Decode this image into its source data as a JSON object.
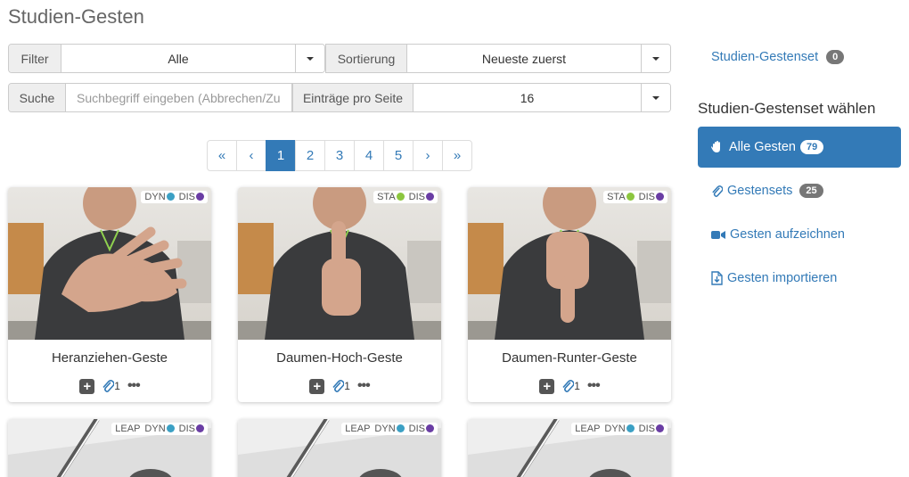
{
  "page": {
    "title": "Studien-Gesten"
  },
  "filter": {
    "label": "Filter",
    "value": "Alle"
  },
  "sort": {
    "label": "Sortierung",
    "value": "Neueste zuerst"
  },
  "search": {
    "label": "Suche",
    "placeholder": "Suchbegriff eingeben (Abbrechen/Zurücksetzen mit ESC)"
  },
  "per_page": {
    "label": "Einträge pro Seite",
    "value": "16"
  },
  "pagination": {
    "first": "«",
    "prev": "‹",
    "pages": [
      "1",
      "2",
      "3",
      "4",
      "5"
    ],
    "next": "›",
    "last": "»",
    "active": "1"
  },
  "cards": [
    {
      "title": "Heranziehen-Geste",
      "tags": [
        {
          "text": "DYN",
          "color": "#3ba0c4"
        },
        {
          "text": "DIS",
          "color": "#6a3da4"
        }
      ],
      "attachments": "1"
    },
    {
      "title": "Daumen-Hoch-Geste",
      "tags": [
        {
          "text": "STA",
          "color": "#8cc63f"
        },
        {
          "text": "DIS",
          "color": "#6a3da4"
        }
      ],
      "attachments": "1"
    },
    {
      "title": "Daumen-Runter-Geste",
      "tags": [
        {
          "text": "STA",
          "color": "#8cc63f"
        },
        {
          "text": "DIS",
          "color": "#6a3da4"
        }
      ],
      "attachments": "1"
    },
    {
      "title": "",
      "tags": [
        {
          "text": "LEAP",
          "color": ""
        },
        {
          "text": "DYN",
          "color": "#3ba0c4"
        },
        {
          "text": "DIS",
          "color": "#6a3da4"
        }
      ],
      "attachments": ""
    },
    {
      "title": "",
      "tags": [
        {
          "text": "LEAP",
          "color": ""
        },
        {
          "text": "DYN",
          "color": "#3ba0c4"
        },
        {
          "text": "DIS",
          "color": "#6a3da4"
        }
      ],
      "attachments": ""
    },
    {
      "title": "",
      "tags": [
        {
          "text": "LEAP",
          "color": ""
        },
        {
          "text": "DYN",
          "color": "#3ba0c4"
        },
        {
          "text": "DIS",
          "color": "#6a3da4"
        }
      ],
      "attachments": ""
    }
  ],
  "sidebar": {
    "study_set": {
      "label": "Studien-Gestenset",
      "count": "0"
    },
    "heading": "Studien-Gestenset wählen",
    "items": [
      {
        "label": "Alle Gesten",
        "count": "79",
        "icon": "hand-icon"
      },
      {
        "label": "Gestensets",
        "count": "25",
        "icon": "paperclip-icon"
      },
      {
        "label": "Gesten aufzeichnen",
        "icon": "video-camera-icon"
      },
      {
        "label": "Gesten importieren",
        "icon": "file-import-icon"
      }
    ]
  },
  "colors": {
    "accent": "#337ab7",
    "dyn": "#3ba0c4",
    "sta": "#8cc63f",
    "dis": "#6a3da4"
  }
}
